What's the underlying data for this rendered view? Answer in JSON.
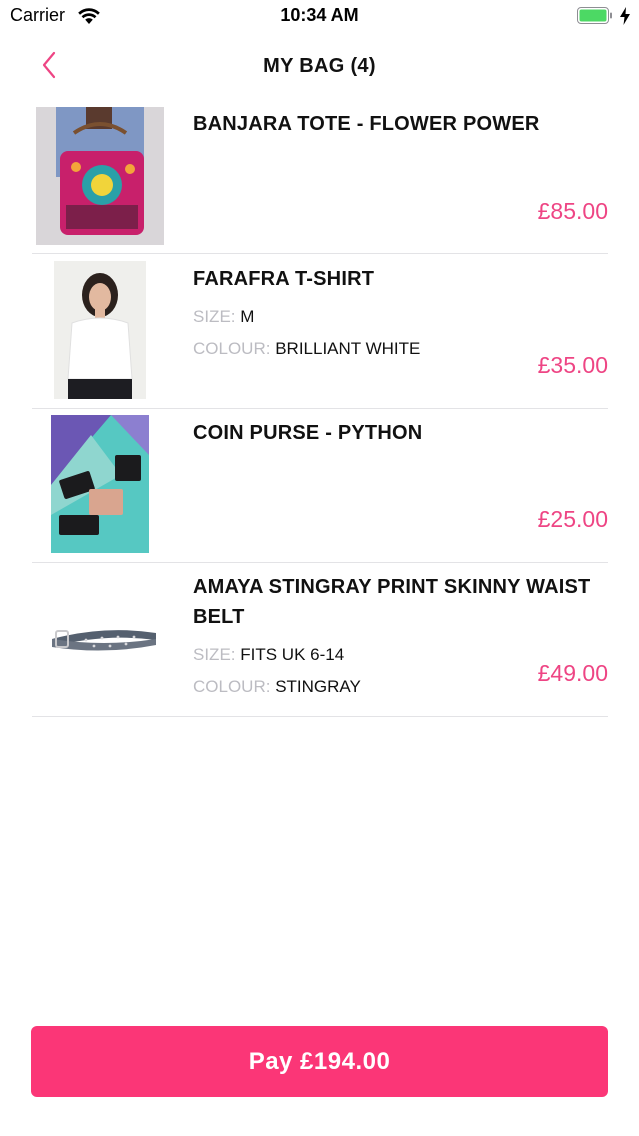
{
  "status_bar": {
    "carrier": "Carrier",
    "time": "10:34 AM",
    "battery_level": 1.0,
    "battery_color": "#4cd964"
  },
  "nav": {
    "title": "MY BAG (4)",
    "back_icon": "chevron-left-icon",
    "accent_color": "#ee4584"
  },
  "items": [
    {
      "name": "BANJARA TOTE - FLOWER POWER",
      "price": "£85.00",
      "attributes": []
    },
    {
      "name": "FARAFRA T-SHIRT",
      "price": "£35.00",
      "attributes": [
        {
          "key": "SIZE:",
          "value": "M"
        },
        {
          "key": "COLOUR:",
          "value": "BRILLIANT WHITE"
        }
      ]
    },
    {
      "name": "COIN PURSE - PYTHON",
      "price": "£25.00",
      "attributes": []
    },
    {
      "name": "AMAYA STINGRAY PRINT SKINNY WAIST BELT",
      "price": "£49.00",
      "attributes": [
        {
          "key": "SIZE:",
          "value": "FITS UK 6-14"
        },
        {
          "key": "COLOUR:",
          "value": "STINGRAY"
        }
      ]
    }
  ],
  "pay_button": {
    "label": "Pay £194.00",
    "color": "#fb3677"
  }
}
